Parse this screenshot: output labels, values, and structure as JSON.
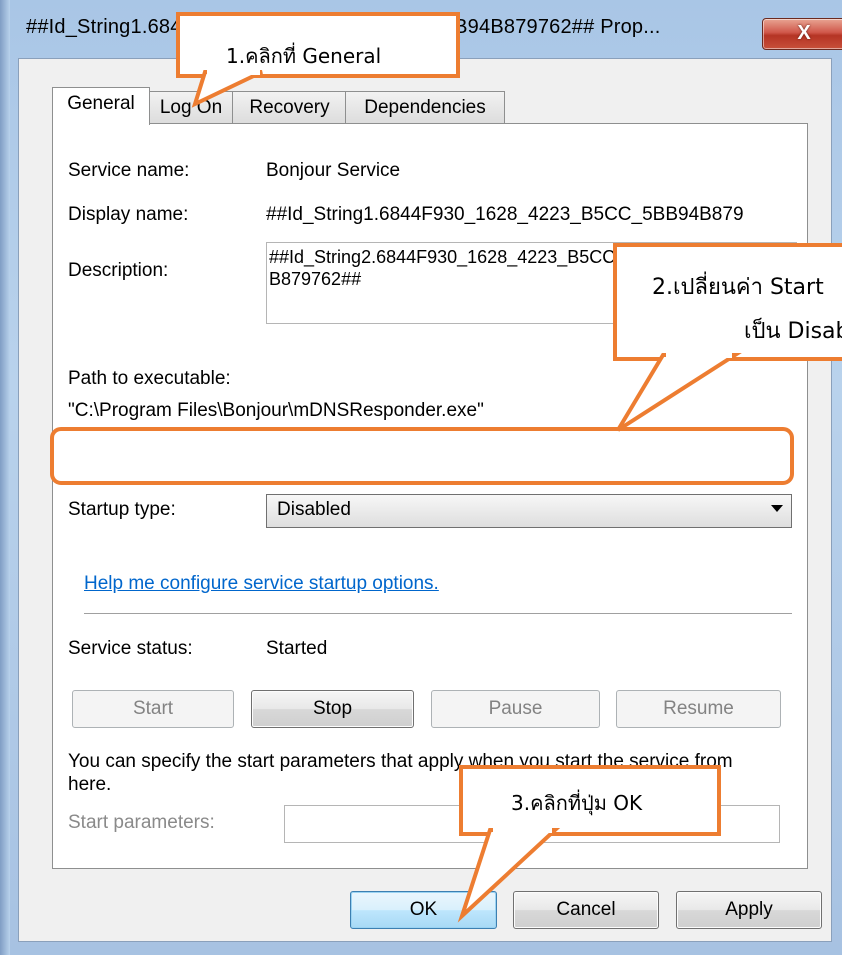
{
  "dialog": {
    "title": "##Id_String1.6844F930_1628_4223_B5CC_5BB94B879762## Prop...",
    "close_label": "X"
  },
  "tabs": [
    {
      "label": "General",
      "active": true
    },
    {
      "label": "Log On",
      "active": false
    },
    {
      "label": "Recovery",
      "active": false
    },
    {
      "label": "Dependencies",
      "active": false
    }
  ],
  "general": {
    "service_name_label": "Service name:",
    "service_name_value": "Bonjour Service",
    "display_name_label": "Display name:",
    "display_name_value": "##Id_String1.6844F930_1628_4223_B5CC_5BB94B879",
    "description_label": "Description:",
    "description_value": "##Id_String2.6844F930_1628_4223_B5CC_5BB94\nB879762##",
    "path_label": "Path to executable:",
    "path_value": "\"C:\\Program Files\\Bonjour\\mDNSResponder.exe\"",
    "startup_type_label": "Startup type:",
    "startup_type_value": "Disabled",
    "help_link": "Help me configure service startup options.",
    "service_status_label": "Service status:",
    "service_status_value": "Started",
    "start_label": "Start",
    "stop_label": "Stop",
    "pause_label": "Pause",
    "resume_label": "Resume",
    "hint_text": "You can specify the start parameters that apply when you start the service from here.",
    "start_params_label": "Start parameters:",
    "start_params_value": ""
  },
  "footer": {
    "ok_label": "OK",
    "cancel_label": "Cancel",
    "apply_label": "Apply"
  },
  "annotations": {
    "step1": "1.คลิกที่ General",
    "step2_line1": "2.เปลี่ยนค่า Start",
    "step2_line2": "เป็น Disab",
    "step3": "3.คลิกที่ปุ่ม OK",
    "highlight_color": "#ed7d31"
  }
}
